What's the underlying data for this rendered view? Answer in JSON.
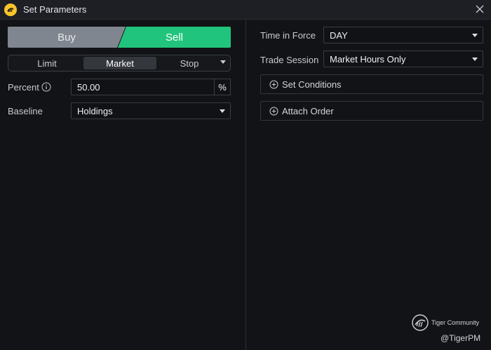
{
  "window": {
    "title": "Set Parameters",
    "icons": {
      "app": "tiger-logo-icon",
      "close": "close-icon"
    }
  },
  "side": {
    "buy_label": "Buy",
    "sell_label": "Sell",
    "selected": "Sell"
  },
  "order_types": {
    "items": [
      "Limit",
      "Market",
      "Stop"
    ],
    "selected": "Market"
  },
  "percent": {
    "label": "Percent",
    "value": "50.00",
    "unit": "%"
  },
  "baseline": {
    "label": "Baseline",
    "value": "Holdings"
  },
  "time_in_force": {
    "label": "Time in Force",
    "value": "DAY"
  },
  "trade_session": {
    "label": "Trade Session",
    "value": "Market Hours Only"
  },
  "options": {
    "set_conditions": "Set Conditions",
    "attach_order": "Attach Order"
  },
  "watermark": {
    "brand": "Tiger Community",
    "handle": "@TigerPM"
  },
  "colors": {
    "sell_accent": "#21c47c",
    "buy_inactive": "#80868f",
    "background": "#121316",
    "logo": "#f7c52b"
  }
}
